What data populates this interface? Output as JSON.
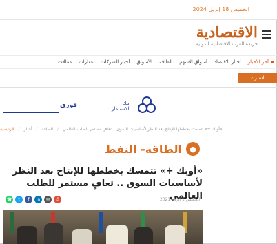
{
  "topbar": {
    "date": "الخميس 18 إبريل 2024"
  },
  "logo": {
    "name": "الاقتصادية",
    "tagline": "جريدة العرب الاقتصادية الدولية"
  },
  "nav": {
    "items": [
      {
        "label": "آخر الأخبار"
      },
      {
        "label": "أخبار الاقتصاد"
      },
      {
        "label": "أسواق الأسهم"
      },
      {
        "label": "الطاقة"
      },
      {
        "label": "الأسواق"
      },
      {
        "label": "أخبار الشركات"
      },
      {
        "label": "عقارات"
      },
      {
        "label": "مقالات"
      }
    ]
  },
  "subscribe_label": "اشترك",
  "ads": {
    "left_text": "فوري",
    "mid_text_1": "بنك",
    "mid_text_2": "الاستثمار"
  },
  "breadcrumbs": [
    "الرئيسية",
    "أخبار",
    "الطاقة",
    "«أوبك +» تتمسك بخططها للإنتاج بعد النظر لأساسيات السوق .. تعافٍ مستمر للطلب العالمي"
  ],
  "section": {
    "title": "الطاقة- النفط"
  },
  "headline": "«أوبك +» تتمسك بخططها للإنتاج بعد النظر لأساسيات السوق .. تعافٍ مستمر للطلب العالمي",
  "dateline": "الخميس 1 إبريل 2021",
  "share": [
    "whatsapp-icon",
    "twitter-icon",
    "facebook-icon",
    "linkedin-icon",
    "email-icon",
    "print-icon"
  ],
  "colors": {
    "accent": "#d96f22",
    "link": "#1f3b8f"
  }
}
